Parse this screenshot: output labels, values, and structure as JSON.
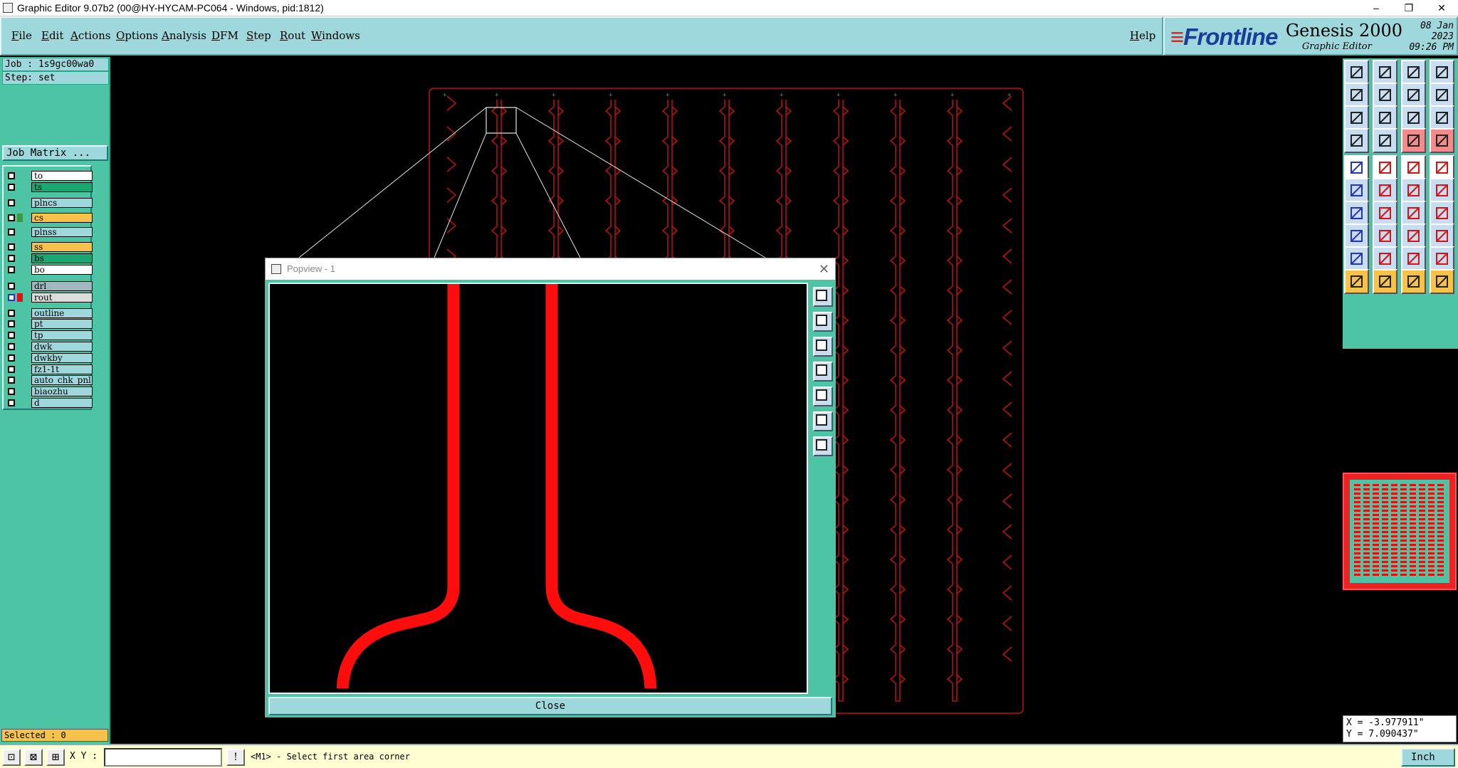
{
  "window": {
    "title": "Graphic Editor 9.07b2 (00@HY-HYCAM-PC064 - Windows, pid:1812)",
    "controls": {
      "minimize": "–",
      "maximize": "❐",
      "close": "✕"
    }
  },
  "menu": {
    "items": [
      "File",
      "Edit",
      "Actions",
      "Options",
      "Analysis",
      "DFM",
      "Step",
      "Rout",
      "Windows"
    ],
    "help": "Help"
  },
  "brand": {
    "logo": "Frontline",
    "product": "Genesis 2000",
    "subtitle": "Graphic Editor",
    "date": "08 Jan 2023",
    "time": "09:26 PM"
  },
  "left": {
    "job": "Job : 1s9gc00wa0",
    "step": "Step: set",
    "job_matrix": "Job Matrix ...",
    "layers": [
      {
        "name": "to",
        "color": "#ffffff"
      },
      {
        "name": "ts",
        "color": "#1aa872"
      },
      {
        "name": "plncs",
        "color": "#9fd8dc"
      },
      {
        "name": "cs",
        "color": "#f6c24a",
        "swatch": "#3a9a3a"
      },
      {
        "name": "plnss",
        "color": "#9fd8dc"
      },
      {
        "name": "ss",
        "color": "#f6c24a"
      },
      {
        "name": "bs",
        "color": "#1aa872"
      },
      {
        "name": "bo",
        "color": "#ffffff"
      },
      {
        "name": "drl",
        "color": "#9fb8c0"
      },
      {
        "name": "rout",
        "color": "#dddddd",
        "swatch": "#e01010",
        "active": true
      },
      {
        "name": "outline",
        "color": "#9fd8dc"
      },
      {
        "name": "pt",
        "color": "#9fd8dc"
      },
      {
        "name": "tp",
        "color": "#9fd8dc"
      },
      {
        "name": "dwk",
        "color": "#9fd8dc"
      },
      {
        "name": "dwkby",
        "color": "#9fd8dc"
      },
      {
        "name": "fz1-1t",
        "color": "#9fd8dc"
      },
      {
        "name": "auto_chk_pnl",
        "color": "#9fd8dc"
      },
      {
        "name": "biaozhu",
        "color": "#9fd8dc"
      },
      {
        "name": "d",
        "color": "#9fd8dc"
      }
    ],
    "selected": "Selected : 0"
  },
  "status": {
    "xy_label": "X Y :",
    "xy_value": "",
    "prompt": "<M1> - Select first area corner",
    "unit": "Inch"
  },
  "coords": {
    "x": "X = -3.977911\"",
    "y": "Y = 7.090437\""
  },
  "popview": {
    "title": "Popview - 1",
    "close": "Close"
  },
  "colors": {
    "panel": "#4dc4a4",
    "menu": "#9fd8dc",
    "rout": "#e01010",
    "highlight": "#f6c24a"
  }
}
